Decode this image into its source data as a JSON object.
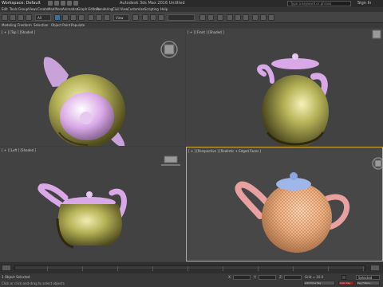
{
  "titlebar": {
    "workspace": "Workspace: Default",
    "title": "Autodesk 3ds Max 2016   Untitled",
    "search_placeholder": "Type a keyword or phrase",
    "sign_in": "Sign In"
  },
  "menu": [
    "Edit",
    "Tools",
    "Group",
    "Views",
    "Create",
    "Modifiers",
    "Animation",
    "Graph Editors",
    "Rendering",
    "Civil View",
    "Customize",
    "Scripting",
    "Help"
  ],
  "toolbar": {
    "selection_filter": "All",
    "view_dropdown": "View"
  },
  "ribbon": [
    "Modeling",
    "Freeform",
    "Selection",
    "Object Paint",
    "Populate"
  ],
  "viewports": {
    "top": {
      "label": "[ + ] [Top ] [Shaded ]"
    },
    "front": {
      "label": "[ + ] [Front ] [Shaded ]"
    },
    "left": {
      "label": "[ + ] [Left ] [Shaded ]"
    },
    "perspective": {
      "label": "[ + ] [Perspective ] [Realistic + Edged Faces ]"
    }
  },
  "timeline": {
    "frame_display": "0 / 100"
  },
  "status": {
    "selection_info": "1 Object Selected",
    "prompt": "Click or click-and-drag to select objects",
    "x_label": "X:",
    "x_value": "",
    "y_label": "Y:",
    "y_value": "",
    "z_label": "Z:",
    "z_value": "",
    "grid": "Grid = 10.0",
    "auto_key": "Auto Key",
    "set_key": "Set Key",
    "key_filter": "Selected",
    "add_time_tag": "Add Time Tag",
    "key_filters": "Key Filters..."
  },
  "colors": {
    "teapot_body": "#b5b258",
    "teapot_lid": "#d9a8e6",
    "persp_body": "#e8b48a",
    "persp_lid": "#9fb6e8",
    "active_viewport_border": "#d8b040"
  }
}
